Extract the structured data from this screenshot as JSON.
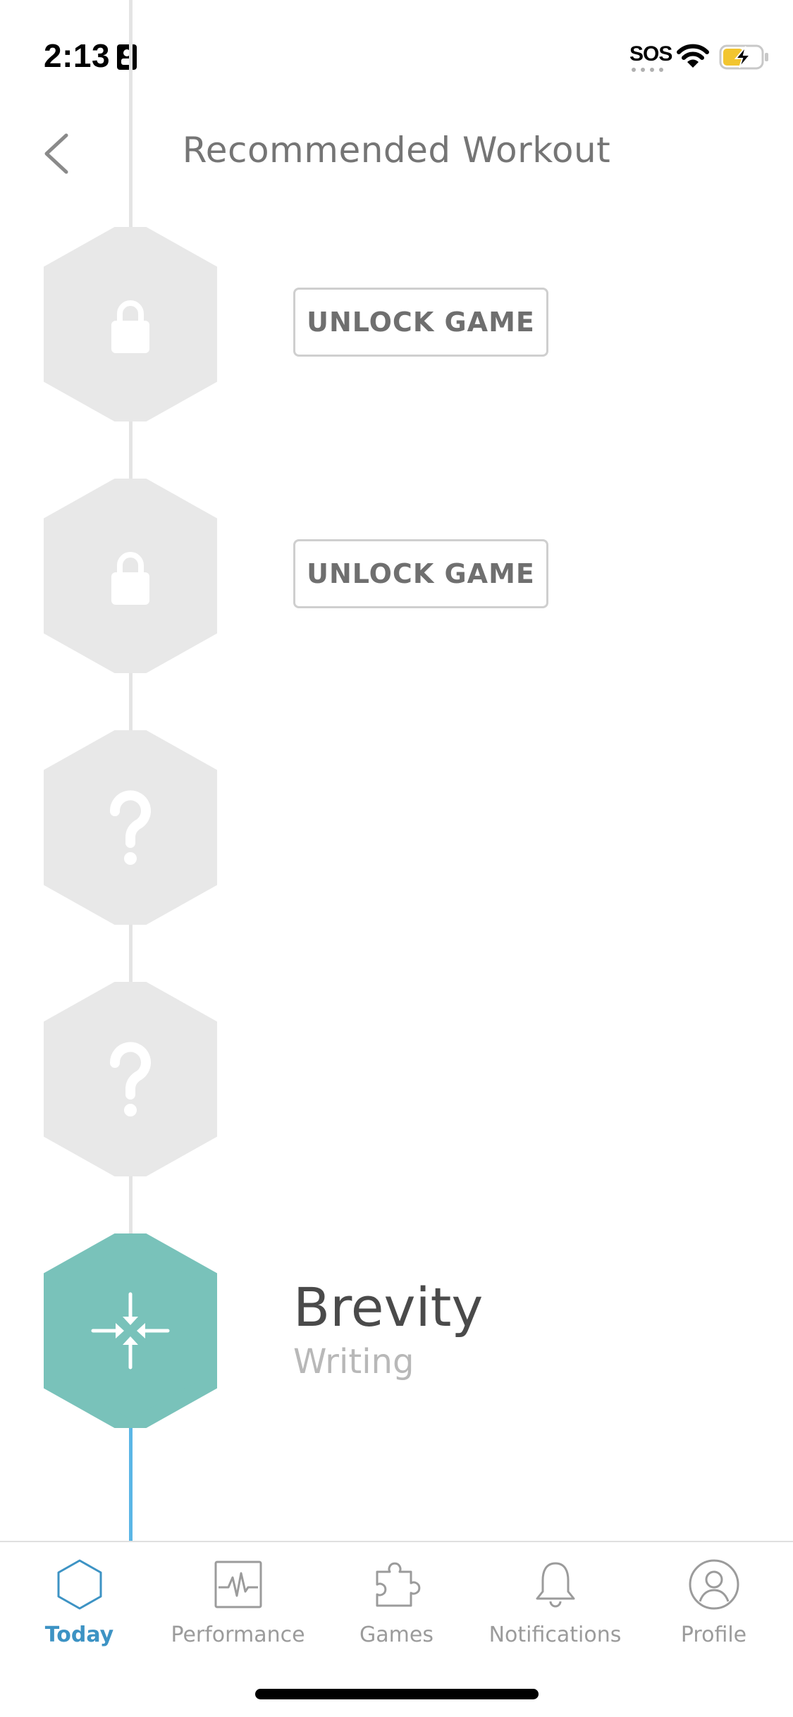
{
  "status_bar": {
    "time": "2:13",
    "sos": "SOS"
  },
  "header": {
    "title": "Recommended Workout"
  },
  "workout": {
    "locked_items": [
      {
        "button_label": "UNLOCK GAME"
      },
      {
        "button_label": "UNLOCK GAME"
      }
    ],
    "current_game": {
      "name": "Brevity",
      "category": "Writing"
    }
  },
  "colors": {
    "node_inactive": "#e8e8e8",
    "node_active": "#79c2ba",
    "timeline_gray": "#e4e4e4",
    "timeline_blue": "#5bb6e6",
    "tab_active": "#3d93c4",
    "tab_inactive": "#9b9b9b"
  },
  "tab_bar": {
    "tabs": [
      {
        "label": "Today",
        "icon": "hexagon-icon",
        "active": true
      },
      {
        "label": "Performance",
        "icon": "pulse-chart-icon",
        "active": false
      },
      {
        "label": "Games",
        "icon": "puzzle-piece-icon",
        "active": false
      },
      {
        "label": "Notifications",
        "icon": "bell-icon",
        "active": false
      },
      {
        "label": "Profile",
        "icon": "person-circle-icon",
        "active": false
      }
    ]
  }
}
